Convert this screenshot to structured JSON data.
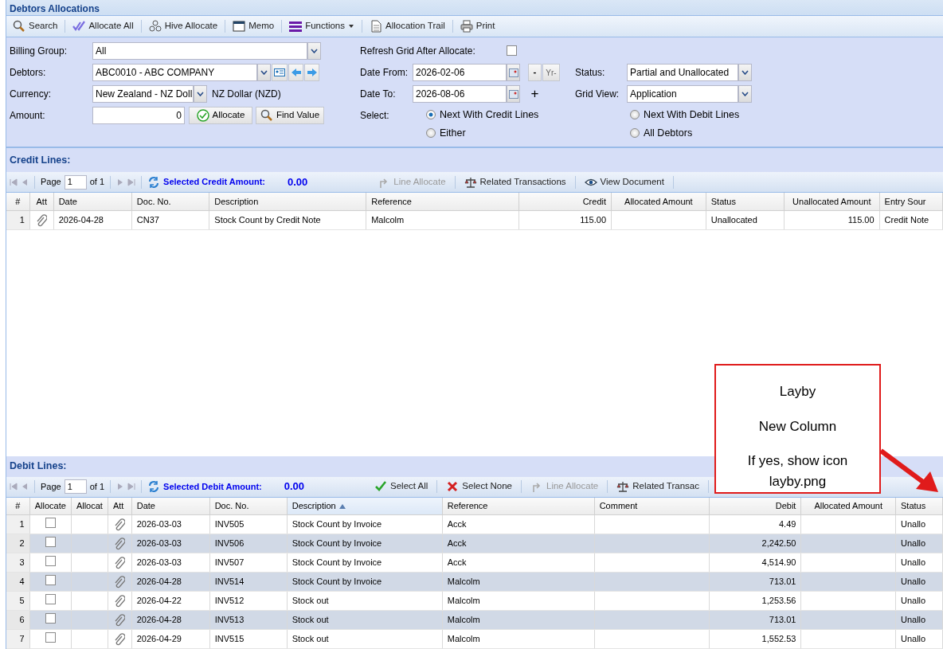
{
  "window": {
    "title": "Debtors Allocations"
  },
  "toolbar": [
    {
      "label": "Search"
    },
    {
      "label": "Allocate All"
    },
    {
      "label": "Hive Allocate"
    },
    {
      "label": "Memo"
    },
    {
      "label": "Functions",
      "dropdown": true
    },
    {
      "label": "Allocation Trail"
    },
    {
      "label": "Print"
    }
  ],
  "form": {
    "billing_group": {
      "label": "Billing Group:",
      "value": "All"
    },
    "debtors": {
      "label": "Debtors:",
      "value": "ABC0010 - ABC COMPANY"
    },
    "currency": {
      "label": "Currency:",
      "value": "New Zealand - NZ Doll",
      "note": "NZ Dollar (NZD)"
    },
    "amount": {
      "label": "Amount:",
      "value": "0",
      "allocate_button": "Allocate",
      "find_button": "Find Value"
    },
    "refresh": {
      "label": "Refresh Grid After Allocate:",
      "checked": false
    },
    "date_from": {
      "label": "Date From:",
      "value": "2026-02-06",
      "minus": "-",
      "year": "Yr-"
    },
    "date_to": {
      "label": "Date To:",
      "value": "2026-08-06",
      "plus": "+"
    },
    "status": {
      "label": "Status:",
      "value": "Partial and Unallocated"
    },
    "grid_view": {
      "label": "Grid View:",
      "value": "Application"
    },
    "select": {
      "label": "Select:",
      "options": [
        {
          "label": "Next With Credit Lines",
          "selected": true
        },
        {
          "label": "Next With Debit Lines",
          "selected": false
        },
        {
          "label": "Either",
          "selected": false
        },
        {
          "label": "All Debtors",
          "selected": false
        }
      ]
    }
  },
  "credit": {
    "title": "Credit Lines:",
    "pager": {
      "page_label": "Page",
      "page": "1",
      "of": "of 1"
    },
    "amount_label": "Selected Credit Amount:",
    "amount": "0.00",
    "tools": [
      {
        "label": "Line Allocate",
        "disabled": true
      },
      {
        "label": "Related Transactions",
        "disabled": false
      },
      {
        "label": "View Document",
        "disabled": false
      }
    ],
    "columns": [
      {
        "label": "#"
      },
      {
        "label": "Att"
      },
      {
        "label": "Date"
      },
      {
        "label": "Doc. No."
      },
      {
        "label": "Description"
      },
      {
        "label": "Reference"
      },
      {
        "label": "Credit"
      },
      {
        "label": "Allocated Amount"
      },
      {
        "label": "Status"
      },
      {
        "label": "Unallocated Amount"
      },
      {
        "label": "Entry Sour"
      }
    ],
    "rows": [
      [
        "1",
        "",
        "2026-04-28",
        "CN37",
        "Stock Count by Credit Note",
        "Malcolm",
        "115.00",
        "",
        "Unallocated",
        "115.00",
        "Credit Note"
      ]
    ]
  },
  "debit": {
    "title": "Debit Lines:",
    "pager": {
      "page_label": "Page",
      "page": "1",
      "of": "of 1"
    },
    "amount_label": "Selected Debit Amount:",
    "amount": "0.00",
    "tools": [
      {
        "label": "Select All",
        "disabled": false
      },
      {
        "label": "Select None",
        "disabled": false
      },
      {
        "label": "Line Allocate",
        "disabled": true
      },
      {
        "label": "Related Transac",
        "disabled": false
      }
    ],
    "columns": [
      {
        "label": "#"
      },
      {
        "label": "Allocate"
      },
      {
        "label": "Allocat"
      },
      {
        "label": "Att"
      },
      {
        "label": "Date"
      },
      {
        "label": "Doc. No."
      },
      {
        "label": "Description",
        "sorted": true
      },
      {
        "label": "Reference"
      },
      {
        "label": "Comment"
      },
      {
        "label": "Debit"
      },
      {
        "label": "Allocated Amount"
      },
      {
        "label": "Status"
      }
    ],
    "rows": [
      {
        "n": "1",
        "checked": false,
        "date": "2026-03-03",
        "doc": "INV505",
        "desc": "Stock Count by Invoice",
        "ref": "Acck",
        "debit": "4.49",
        "status": "Unallo"
      },
      {
        "n": "2",
        "checked": false,
        "date": "2026-03-03",
        "doc": "INV506",
        "desc": "Stock Count by Invoice",
        "ref": "Acck",
        "debit": "2,242.50",
        "status": "Unallo"
      },
      {
        "n": "3",
        "checked": false,
        "date": "2026-03-03",
        "doc": "INV507",
        "desc": "Stock Count by Invoice",
        "ref": "Acck",
        "debit": "4,514.90",
        "status": "Unallo"
      },
      {
        "n": "4",
        "checked": false,
        "date": "2026-04-28",
        "doc": "INV514",
        "desc": "Stock Count by Invoice",
        "ref": "Malcolm",
        "debit": "713.01",
        "status": "Unallo"
      },
      {
        "n": "5",
        "checked": false,
        "date": "2026-04-22",
        "doc": "INV512",
        "desc": "Stock out",
        "ref": "Malcolm",
        "debit": "1,253.56",
        "status": "Unallo"
      },
      {
        "n": "6",
        "checked": false,
        "date": "2026-04-28",
        "doc": "INV513",
        "desc": "Stock out",
        "ref": "Malcolm",
        "debit": "713.01",
        "status": "Unallo"
      },
      {
        "n": "7",
        "checked": false,
        "date": "2026-04-29",
        "doc": "INV515",
        "desc": "Stock out",
        "ref": "Malcolm",
        "debit": "1,552.53",
        "status": "Unallo"
      }
    ]
  },
  "callout": {
    "lines": [
      "Layby",
      "New Column",
      "If yes, show icon layby.png"
    ]
  }
}
